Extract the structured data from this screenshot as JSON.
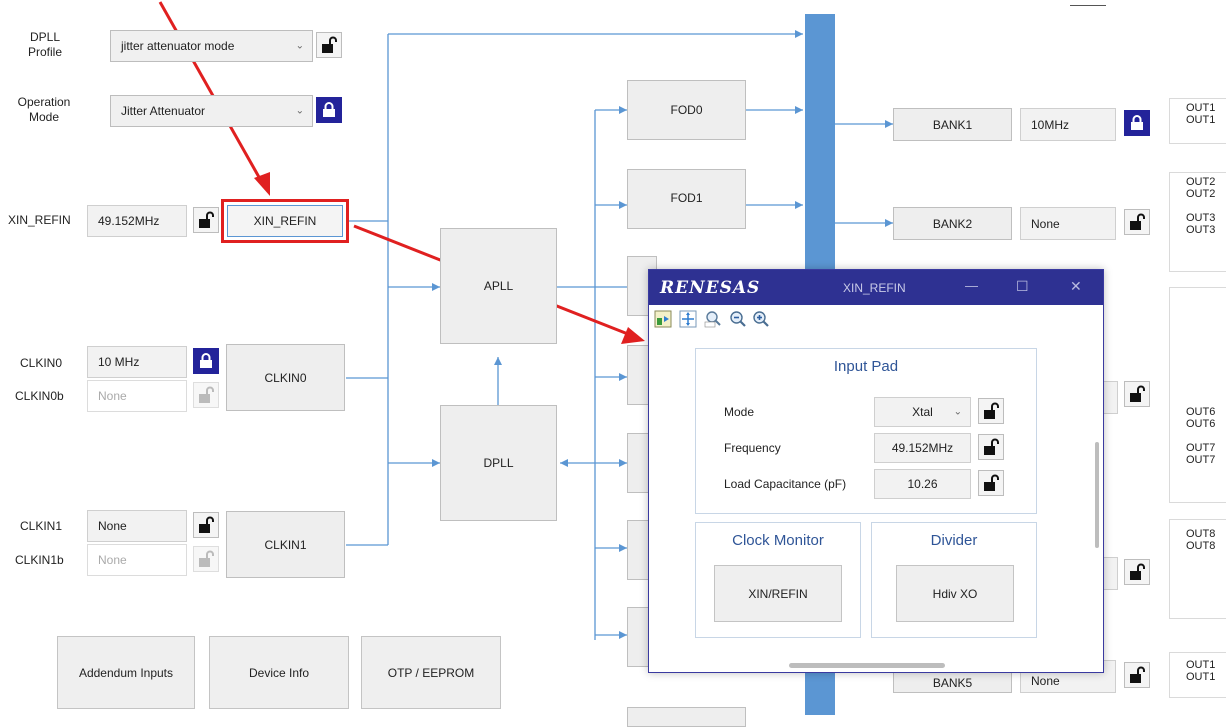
{
  "left_panel": {
    "dpll_profile_label": "DPLL\nProfile",
    "dpll_profile_value": "jitter attenuator mode",
    "operation_mode_label": "Operation\nMode",
    "operation_mode_value": "Jitter Attenuator",
    "xin_refin_label": "XIN_REFIN",
    "xin_refin_value": "49.152MHz",
    "xin_refin_block": "XIN_REFIN",
    "clkin0_label": "CLKIN0",
    "clkin0_value": "10 MHz",
    "clkin0b_label": "CLKIN0b",
    "clkin0b_value": "None",
    "clkin0_block": "CLKIN0",
    "clkin1_label": "CLKIN1",
    "clkin1_value": "None",
    "clkin1b_label": "CLKIN1b",
    "clkin1b_value": "None",
    "clkin1_block": "CLKIN1"
  },
  "bottom_buttons": {
    "addendum": "Addendum Inputs",
    "device_info": "Device Info",
    "otp": "OTP / EEPROM"
  },
  "blocks": {
    "apll": "APLL",
    "dpll": "DPLL",
    "fod0": "FOD0",
    "fod1": "FOD1"
  },
  "banks": {
    "bank1": "BANK1",
    "bank1_freq": "10MHz",
    "bank2": "BANK2",
    "bank2_freq": "None",
    "bank5": "BANK5",
    "bank5_freq": "None"
  },
  "outputs": {
    "o1": "OUT1",
    "o1b": "OUT1",
    "o2": "OUT2",
    "o2b": "OUT2",
    "o3": "OUT3",
    "o3b": "OUT3",
    "o6": "OUT6",
    "o6b": "OUT6",
    "o7": "OUT7",
    "o7b": "OUT7",
    "o8": "OUT8",
    "o8b": "OUT8",
    "o10": "OUT1",
    "o10b": "OUT1"
  },
  "dialog": {
    "brand": "RENESAS",
    "title": "XIN_REFIN",
    "minimize": "—",
    "maximize": "☐",
    "close": "✕",
    "input_pad": {
      "title": "Input Pad",
      "mode_label": "Mode",
      "mode_value": "Xtal",
      "frequency_label": "Frequency",
      "frequency_value": "49.152MHz",
      "load_cap_label": "Load Capacitance (pF)",
      "load_cap_value": "10.26"
    },
    "clock_monitor": {
      "title": "Clock Monitor",
      "button": "XIN/REFIN"
    },
    "divider": {
      "title": "Divider",
      "button": "Hdiv XO"
    }
  },
  "icons": [
    "lock-icon",
    "unlock-icon",
    "dropdown-arrow-icon",
    "fit-icon",
    "pan-icon",
    "zoom-100-icon",
    "zoom-out-icon",
    "zoom-in-icon"
  ],
  "colors": {
    "bus_blue": "#5b96d3",
    "lock_active": "#23239a",
    "dialog_title": "#2e3192",
    "group_title": "#2f5597",
    "annotation_red": "#e02020"
  }
}
